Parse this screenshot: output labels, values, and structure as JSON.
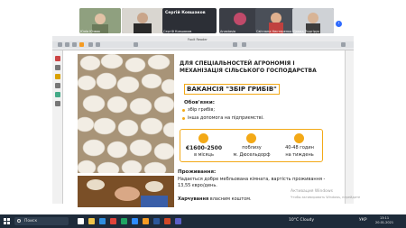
{
  "call": {
    "participants": [
      {
        "name": "Юлія Юзвяк"
      },
      {
        "name": "Сергій Ковшаков"
      },
      {
        "name": "Anastasia"
      },
      {
        "name": "Світлана Нестеренко"
      },
      {
        "name": "Давид Подгірук"
      }
    ],
    "active_speaker": "Сергій Ковшаков"
  },
  "viewer": {
    "title": "Foxit Reader"
  },
  "slide": {
    "heading": "ДЛЯ СПЕЦІАЛЬНОСТЕЙ АГРОНОМІЯ І МЕХАНІЗАЦІЯ СІЛЬСЬКОГО ГОСПОДАРСТВА",
    "vacancy": "ВАКАНСІЯ \"ЗБІР ГРИБІВ\"",
    "duties_title": "Обов'язки:",
    "duties": [
      "збір грибів;",
      "інша допомога на підприємстві."
    ],
    "info": [
      {
        "value": "€1600-2500",
        "sub": "в місяць"
      },
      {
        "value": "поблизу",
        "sub": "м. Дюсельдорф"
      },
      {
        "value": "40-48 годин",
        "sub": "на тиждень"
      }
    ],
    "living_title": "Проживання:",
    "living_text": "Надається добре мебльована кімната, вартість проживання - 13,55 євро/день.",
    "food_bold": "Харчування",
    "food_rest": " власним коштом."
  },
  "watermark": {
    "line1": "Активация Windows",
    "line2": "Чтобы активировать Windows, перейдите"
  },
  "taskbar": {
    "search_placeholder": "Поиск",
    "weather": "10°C Cloudy",
    "lang": "УКР",
    "time": "13:11",
    "date": "20.01.2021"
  },
  "colors": {
    "accent": "#f3a917",
    "taskbar": "#1e2b3a"
  }
}
